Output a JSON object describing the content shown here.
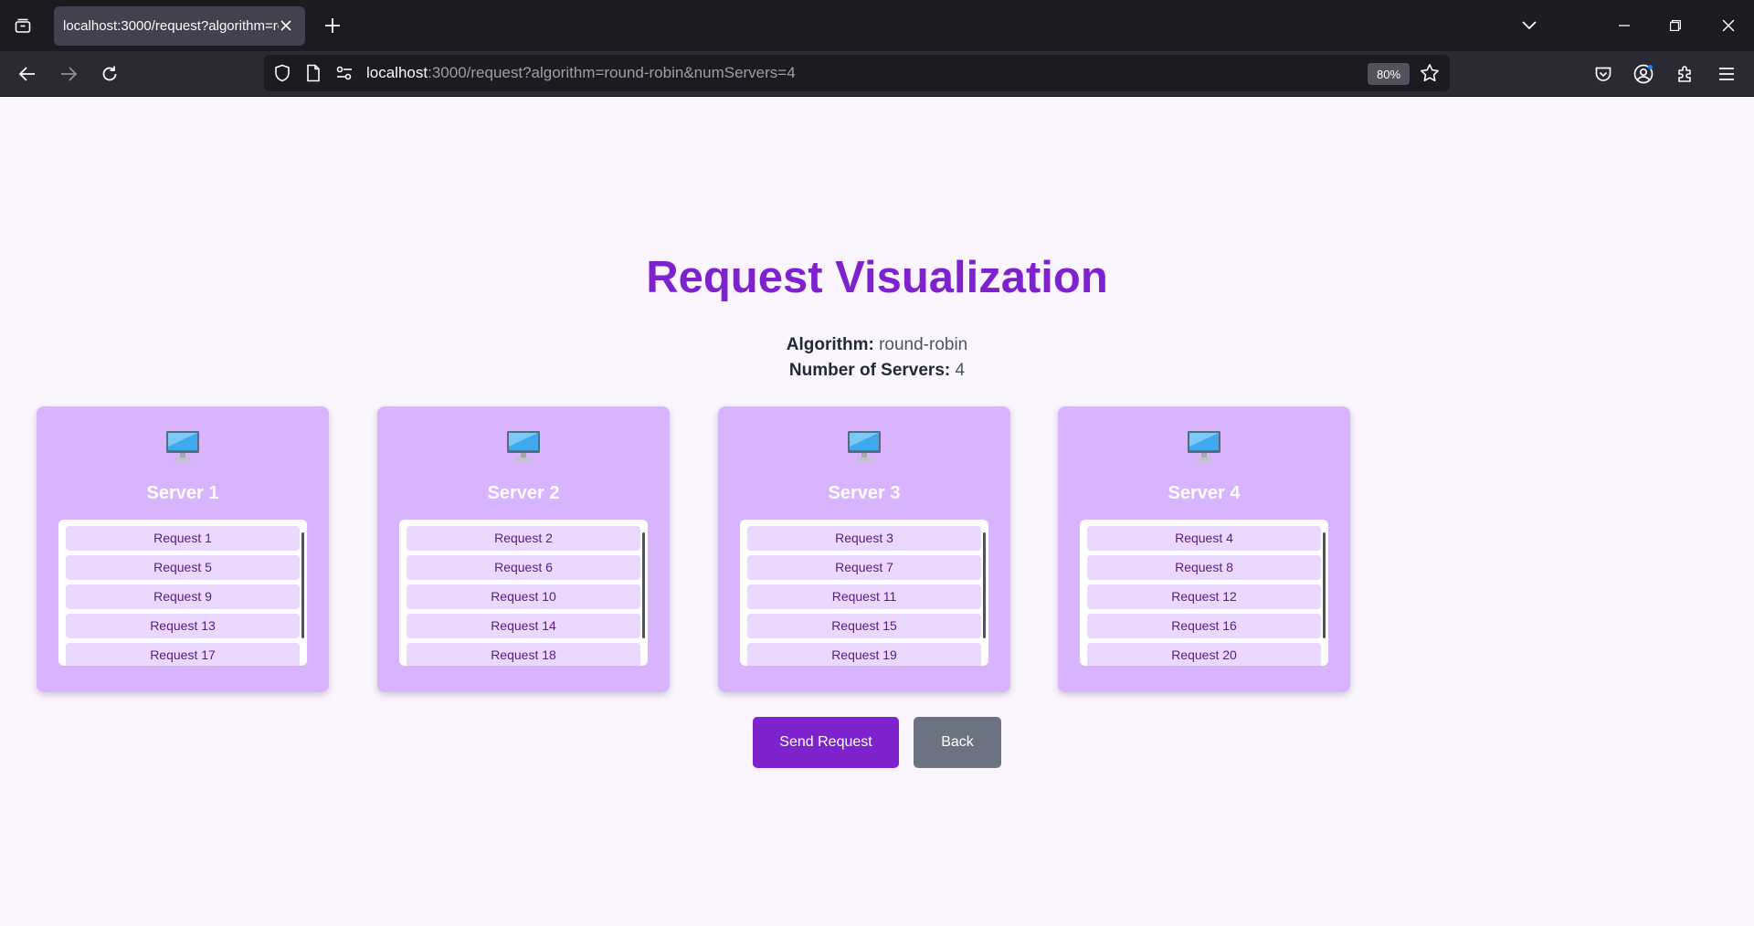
{
  "browser": {
    "tab_title": "localhost:3000/request?algorithm=round-robin&numServers=4",
    "url_host": "localhost",
    "url_rest": ":3000/request?algorithm=round-robin&numServers=4",
    "zoom": "80%"
  },
  "page": {
    "title": "Request Visualization",
    "algorithm_label": "Algorithm:",
    "algorithm_value": "round-robin",
    "servers_label": "Number of Servers:",
    "servers_value": "4"
  },
  "servers": [
    {
      "name": "Server 1",
      "requests": [
        "Request 1",
        "Request 5",
        "Request 9",
        "Request 13",
        "Request 17"
      ]
    },
    {
      "name": "Server 2",
      "requests": [
        "Request 2",
        "Request 6",
        "Request 10",
        "Request 14",
        "Request 18"
      ]
    },
    {
      "name": "Server 3",
      "requests": [
        "Request 3",
        "Request 7",
        "Request 11",
        "Request 15",
        "Request 19"
      ]
    },
    {
      "name": "Server 4",
      "requests": [
        "Request 4",
        "Request 8",
        "Request 12",
        "Request 16",
        "Request 20"
      ]
    }
  ],
  "buttons": {
    "send": "Send Request",
    "back": "Back"
  },
  "colors": {
    "accent": "#7e22ce",
    "server_card": "#d8b4fe",
    "request_item": "#ead8fe",
    "back_button": "#6b7280",
    "page_bg": "#faf5ff"
  }
}
